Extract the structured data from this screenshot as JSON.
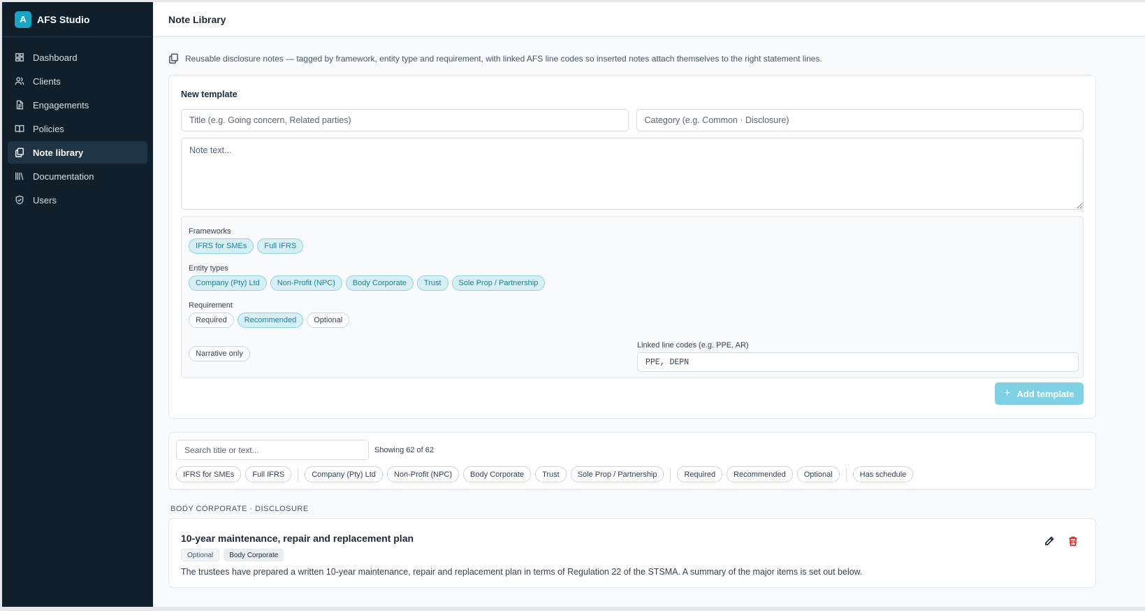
{
  "brand": {
    "logo_letter": "A",
    "name": "AFS Studio"
  },
  "sidebar": {
    "items": [
      {
        "label": "Dashboard",
        "icon": "dashboard-icon"
      },
      {
        "label": "Clients",
        "icon": "users-icon"
      },
      {
        "label": "Engagements",
        "icon": "document-icon"
      },
      {
        "label": "Policies",
        "icon": "book-open-icon"
      },
      {
        "label": "Note library",
        "icon": "copy-icon",
        "active": true
      },
      {
        "label": "Documentation",
        "icon": "library-icon"
      },
      {
        "label": "Users",
        "icon": "shield-icon"
      }
    ]
  },
  "header": {
    "title": "Note Library"
  },
  "intro": "Reusable disclosure notes — tagged by framework, entity type and requirement, with linked AFS line codes so inserted notes attach themselves to the right statement lines.",
  "new_template": {
    "heading": "New template",
    "title_placeholder": "Title (e.g. Going concern, Related parties)",
    "category_placeholder": "Category (e.g. Common · Disclosure)",
    "text_placeholder": "Note text...",
    "frameworks_label": "Frameworks",
    "frameworks": [
      {
        "label": "IFRS for SMEs",
        "on": true
      },
      {
        "label": "Full IFRS",
        "on": true
      }
    ],
    "entity_types_label": "Entity types",
    "entity_types": [
      {
        "label": "Company (Pty) Ltd",
        "on": true
      },
      {
        "label": "Non-Profit (NPC)",
        "on": true
      },
      {
        "label": "Body Corporate",
        "on": true
      },
      {
        "label": "Trust",
        "on": true
      },
      {
        "label": "Sole Prop / Partnership",
        "on": true
      }
    ],
    "requirement_label": "Requirement",
    "requirements": [
      {
        "label": "Required",
        "on": false
      },
      {
        "label": "Recommended",
        "on": true
      },
      {
        "label": "Optional",
        "on": false
      }
    ],
    "narrative_label": "Narrative only",
    "linked_label": "Linked line codes (e.g. PPE, AR)",
    "linked_value": "PPE, DEPN",
    "add_button": "Add template",
    "add_button_icon": "plus-icon"
  },
  "filters": {
    "search_placeholder": "Search title or text...",
    "count": "Showing 62 of 62",
    "frameworks": [
      "IFRS for SMEs",
      "Full IFRS"
    ],
    "entity_types": [
      "Company (Pty) Ltd",
      "Non-Profit (NPC)",
      "Body Corporate",
      "Trust",
      "Sole Prop / Partnership"
    ],
    "requirements": [
      "Required",
      "Recommended",
      "Optional"
    ],
    "extra": [
      "Has schedule"
    ]
  },
  "groups": [
    {
      "heading": "BODY CORPORATE · DISCLOSURE",
      "notes": [
        {
          "title": "10-year maintenance, repair and replacement plan",
          "tags": [
            "Optional",
            "Body Corporate"
          ],
          "text": "The trustees have prepared a written 10-year maintenance, repair and replacement plan in terms of Regulation 22 of the STSMA. A summary of the major items is set out below."
        }
      ]
    }
  ],
  "colors": {
    "sidebar_bg": "#0f1f2b",
    "accent": "#19a3c4",
    "delete": "#dc2626"
  }
}
